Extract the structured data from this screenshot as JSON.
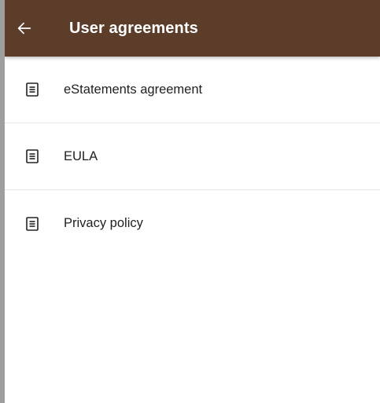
{
  "app_bar": {
    "title": "User agreements",
    "back_icon": "arrow-left-icon",
    "background_color": "#5b3d29",
    "title_color": "#ffffff"
  },
  "agreements": [
    {
      "label": "eStatements agreement",
      "icon": "document-icon"
    },
    {
      "label": "EULA",
      "icon": "document-icon"
    },
    {
      "label": "Privacy policy",
      "icon": "document-icon"
    }
  ]
}
